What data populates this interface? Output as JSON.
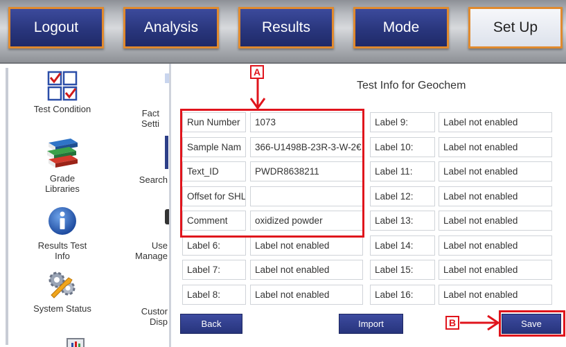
{
  "nav": {
    "logout": "Logout",
    "analysis": "Analysis",
    "results": "Results",
    "mode": "Mode",
    "setup": "Set Up"
  },
  "sidebar": {
    "col1": [
      {
        "label": "Test Condition",
        "icon": "checkbox-grid-icon"
      },
      {
        "label": "Grade Libraries",
        "icon": "books-icon"
      },
      {
        "label": "Results Test Info",
        "icon": "info-icon"
      },
      {
        "label": "System Status",
        "icon": "gears-wrench-icon"
      }
    ],
    "col2": [
      {
        "label": "Fact Setti"
      },
      {
        "label": "Search"
      },
      {
        "label": "Use Manage"
      },
      {
        "label": "Custor Disp"
      }
    ]
  },
  "panel": {
    "title": "Test Info for Geochem",
    "left_rows": [
      {
        "label": "Run Number",
        "value": "1073"
      },
      {
        "label": "Sample Nam",
        "value": "366-U1498B-23R-3-W-2€"
      },
      {
        "label": "Text_ID",
        "value": "PWDR8638211"
      },
      {
        "label": "Offset for SHL",
        "value": ""
      },
      {
        "label": "Comment",
        "value": "oxidized powder"
      },
      {
        "label": "Label 6:",
        "value": "Label not enabled"
      },
      {
        "label": "Label 7:",
        "value": "Label not enabled"
      },
      {
        "label": "Label 8:",
        "value": "Label not enabled"
      }
    ],
    "right_rows": [
      {
        "label": "Label 9:",
        "value": "Label not enabled"
      },
      {
        "label": "Label 10:",
        "value": "Label not enabled"
      },
      {
        "label": "Label 11:",
        "value": "Label not enabled"
      },
      {
        "label": "Label 12:",
        "value": "Label not enabled"
      },
      {
        "label": "Label 13:",
        "value": "Label not enabled"
      },
      {
        "label": "Label 14:",
        "value": "Label not enabled"
      },
      {
        "label": "Label 15:",
        "value": "Label not enabled"
      },
      {
        "label": "Label 16:",
        "value": "Label not enabled"
      }
    ],
    "buttons": {
      "back": "Back",
      "import": "Import",
      "save": "Save"
    }
  },
  "annotations": {
    "a": "A",
    "b": "B",
    "color": "#e0141c"
  },
  "colors": {
    "nav_blue": "#29367d",
    "nav_border": "#e08a2e"
  }
}
